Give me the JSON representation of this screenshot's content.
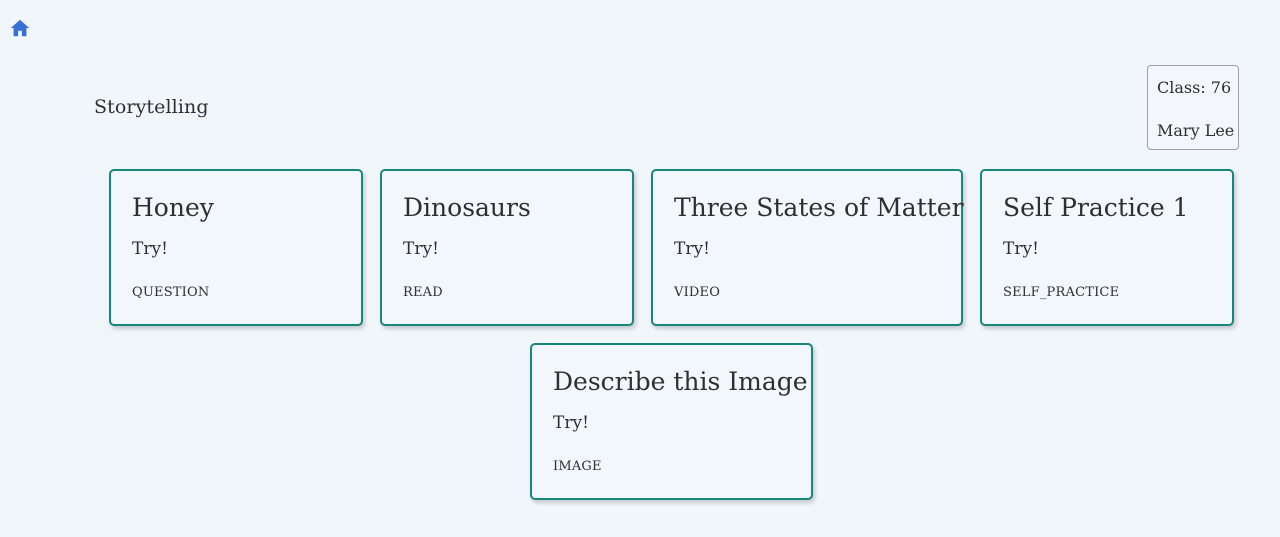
{
  "colors": {
    "background": "#f1f6fb",
    "accent": "#17867b",
    "home_icon": "#3b6fd8",
    "text": "#2f2f2f"
  },
  "nav": {
    "home_icon": "home-icon"
  },
  "page": {
    "title": "Storytelling"
  },
  "user_info": {
    "class_label": "Class: 76",
    "name": "Mary Lee"
  },
  "cards": [
    {
      "title": "Honey",
      "action": "Try!",
      "type": "QUESTION"
    },
    {
      "title": "Dinosaurs",
      "action": "Try!",
      "type": "READ"
    },
    {
      "title": "Three States of Matter",
      "action": "Try!",
      "type": "VIDEO"
    },
    {
      "title": "Self Practice 1",
      "action": "Try!",
      "type": "SELF_PRACTICE"
    },
    {
      "title": "Describe this Image",
      "action": "Try!",
      "type": "IMAGE"
    }
  ]
}
